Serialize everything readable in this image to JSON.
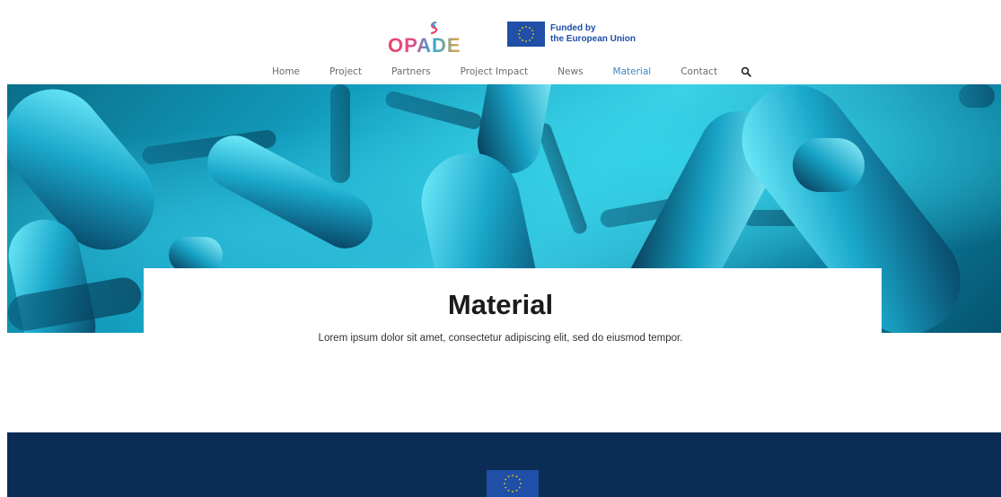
{
  "header": {
    "logo_text": "OPADE",
    "eu_text_line1": "Funded by",
    "eu_text_line2": "the European Union"
  },
  "nav": {
    "items": [
      {
        "label": "Home"
      },
      {
        "label": "Project"
      },
      {
        "label": "Partners"
      },
      {
        "label": "Project Impact"
      },
      {
        "label": "News"
      },
      {
        "label": "Material",
        "active": true
      },
      {
        "label": "Contact"
      }
    ],
    "search_icon": "search-icon"
  },
  "page": {
    "title": "Material",
    "subtitle": "Lorem ipsum dolor sit amet, consectetur adipiscing elit, sed do eiusmod tempor."
  },
  "colors": {
    "nav_text": "#6c6c6c",
    "nav_active": "#3f86c7",
    "footer_bg": "#0b2c54",
    "eu_blue": "#1f4fa6",
    "eu_star": "#f7d117"
  }
}
